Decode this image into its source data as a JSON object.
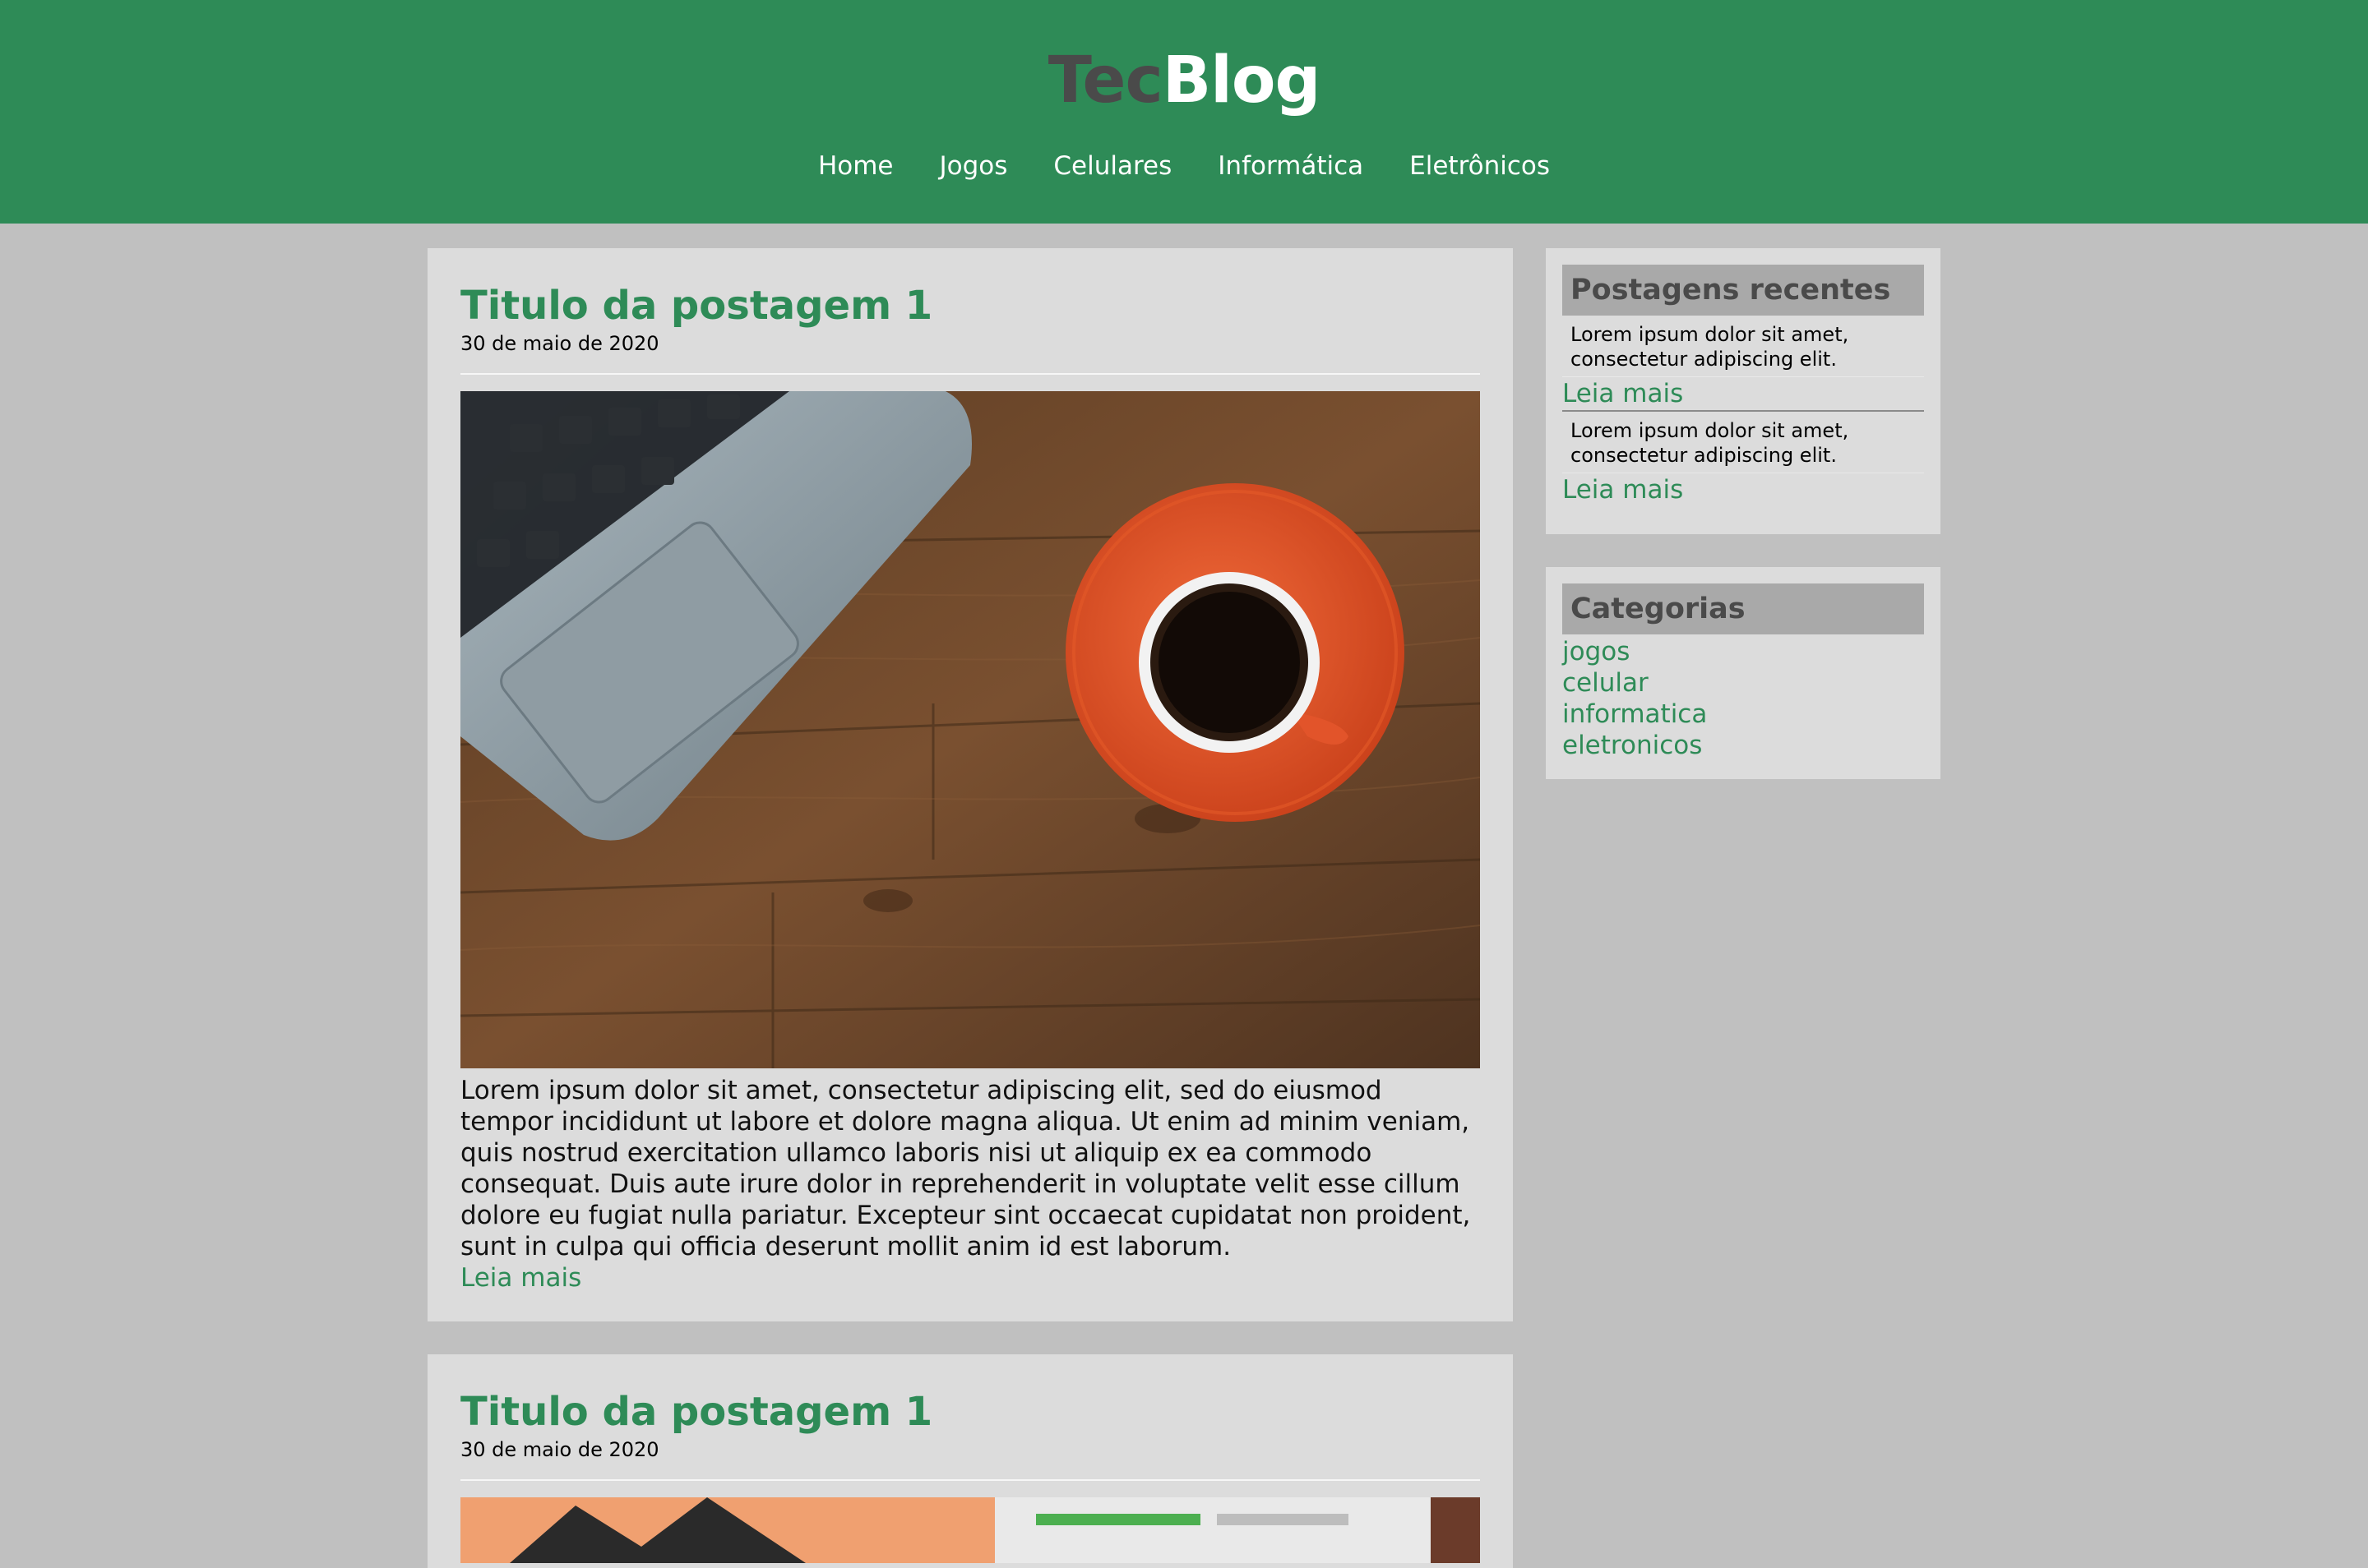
{
  "header": {
    "logo_part1": "Tec",
    "logo_part2": "Blog",
    "nav": [
      "Home",
      "Jogos",
      "Celulares",
      "Informática",
      "Eletrônicos"
    ]
  },
  "posts": [
    {
      "title": "Titulo da postagem 1",
      "date": "30 de maio de 2020",
      "body": "Lorem ipsum dolor sit amet, consectetur adipiscing elit, sed do eiusmod tempor incididunt ut labore et dolore magna aliqua. Ut enim ad minim veniam, quis nostrud exercitation ullamco laboris nisi ut aliquip ex ea commodo consequat. Duis aute irure dolor in reprehenderit in voluptate velit esse cillum dolore eu fugiat nulla pariatur. Excepteur sint occaecat cupidatat non proident, sunt in culpa qui officia deserunt mollit anim id est laborum.",
      "read_more": "Leia mais"
    },
    {
      "title": "Titulo da postagem 1",
      "date": "30 de maio de 2020"
    }
  ],
  "sidebar": {
    "recent_title": "Postagens recentes",
    "recent": [
      {
        "text": "Lorem ipsum dolor sit amet, consectetur adipiscing elit.",
        "link": "Leia mais"
      },
      {
        "text": "Lorem ipsum dolor sit amet, consectetur adipiscing elit.",
        "link": "Leia mais"
      }
    ],
    "categories_title": "Categorias",
    "categories": [
      "jogos",
      "celular",
      "informatica",
      "eletronicos"
    ]
  },
  "colors": {
    "accent": "#2e8b57",
    "background": "#c0c0c0",
    "card": "#dcdcdc",
    "widget_header": "#a9a9a9"
  }
}
